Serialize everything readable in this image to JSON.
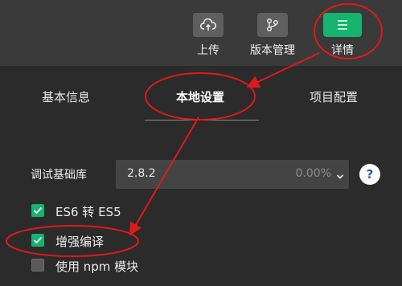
{
  "toolbar": {
    "upload_label": "上传",
    "version_label": "版本管理",
    "details_label": "详情"
  },
  "tabs": [
    {
      "label": "基本信息",
      "active": false
    },
    {
      "label": "本地设置",
      "active": true
    },
    {
      "label": "项目配置",
      "active": false
    }
  ],
  "debug_lib": {
    "label": "调试基础库",
    "version": "2.8.2",
    "usage": "0.00%",
    "help": "?"
  },
  "options": [
    {
      "label": "ES6 转 ES5",
      "checked": true
    },
    {
      "label": "增强编译",
      "checked": true
    },
    {
      "label": "使用 npm 模块",
      "checked": false
    }
  ],
  "colors": {
    "accent": "#16b36f",
    "annotation": "#e0191a",
    "background": "#2b2b2b",
    "toolbar": "#3a3a3a"
  },
  "icons": [
    "cloud-upload-icon",
    "branch-icon",
    "menu-icon",
    "chevron-down-icon",
    "check-icon",
    "help-icon"
  ]
}
